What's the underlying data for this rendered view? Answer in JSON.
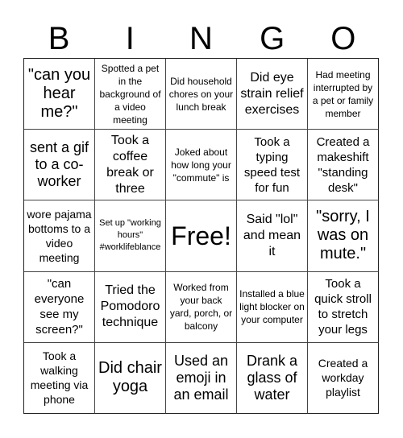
{
  "header": {
    "letters": [
      "B",
      "I",
      "N",
      "G",
      "O"
    ]
  },
  "cells": [
    [
      "\"can you hear me?\"",
      "Spotted a pet in the background of a video meeting",
      "Did household chores on your lunch break",
      "Did eye strain relief exercises",
      "Had meeting interrupted by a pet or family member"
    ],
    [
      "sent a gif to a co-worker",
      "Took a coffee break or three",
      "Joked about how long your \"commute\" is",
      "Took a typing speed test for fun",
      "Created a makeshift \"standing desk\""
    ],
    [
      "wore pajama bottoms to a video meeting",
      "Set up \"working hours\" #worklifeblance",
      "Free!",
      "Said \"lol\" and mean it",
      "\"sorry, I was on mute.\""
    ],
    [
      "\"can everyone see my screen?\"",
      "Tried the Pomodoro technique",
      "Worked from your back yard, porch, or balcony",
      "Installed a blue light blocker on your computer",
      "Took a quick stroll to stretch your legs"
    ],
    [
      "Took a walking meeting via phone",
      "Did chair yoga",
      "Used an emoji in an email",
      "Drank a glass of water",
      "Created a workday playlist"
    ]
  ],
  "free_space": {
    "row": 2,
    "col": 2,
    "label": "Free!"
  }
}
